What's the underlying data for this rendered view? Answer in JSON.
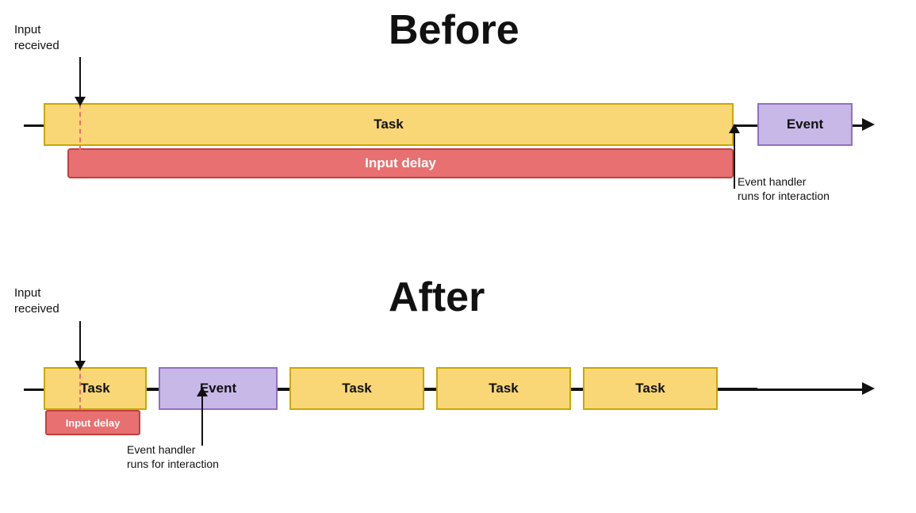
{
  "before": {
    "title": "Before",
    "input_received_label": "Input\nreceived",
    "task_label": "Task",
    "event_label": "Event",
    "input_delay_label": "Input delay",
    "event_handler_label": "Event handler\nruns for interaction"
  },
  "after": {
    "title": "After",
    "input_received_label": "Input\nreceived",
    "task_label_1": "Task",
    "event_label": "Event",
    "task_label_2": "Task",
    "task_label_3": "Task",
    "task_label_4": "Task",
    "input_delay_label": "Input delay",
    "event_handler_label": "Event handler\nruns for interaction"
  },
  "colors": {
    "yellow": "#f9d776",
    "yellow_border": "#c8a800",
    "purple": "#c8b8e8",
    "purple_border": "#9070c0",
    "red": "#e87070",
    "red_border": "#c04040",
    "black": "#111111"
  }
}
